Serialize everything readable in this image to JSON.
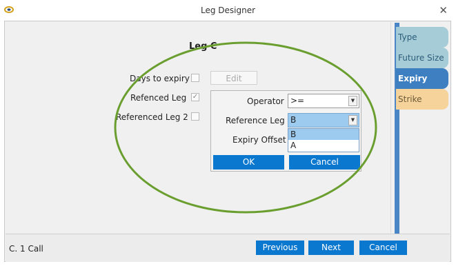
{
  "window": {
    "title": "Leg Designer"
  },
  "tabs": [
    {
      "label": "Type"
    },
    {
      "label": "Future Size"
    },
    {
      "label": "Expiry"
    },
    {
      "label": "Strike"
    }
  ],
  "form": {
    "leg_title": "Leg C",
    "days_to_expiry_label": "Days to expiry",
    "edit_label": "Edit",
    "referenced_leg_label": "Refenced Leg",
    "referenced_leg2_label": "Referenced Leg 2"
  },
  "popup": {
    "operator_label": "Operator",
    "operator_value": ">=",
    "reference_leg_label": "Reference Leg",
    "reference_leg_value": "B",
    "reference_leg_options": [
      "B",
      "A"
    ],
    "expiry_offset_label": "Expiry Offset",
    "ok_label": "OK",
    "cancel_label": "Cancel"
  },
  "footer": {
    "status": "C. 1 Call",
    "previous_label": "Previous",
    "next_label": "Next",
    "cancel_label": "Cancel"
  },
  "colors": {
    "accent_blue": "#0b78d0",
    "tab_teal": "#a6ccd7",
    "tab_active": "#3e7fc1",
    "tab_strike": "#f6d39b",
    "annotation_green": "#6a9e2f"
  }
}
